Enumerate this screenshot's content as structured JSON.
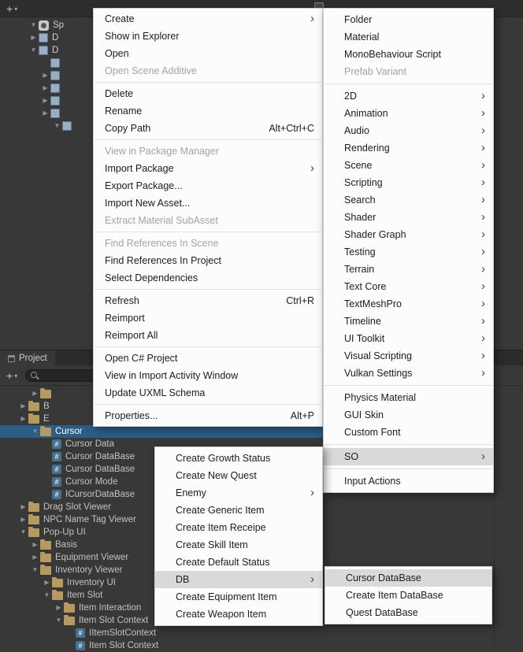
{
  "colors": {
    "selection_blue": "#2c5d87",
    "menu_highlight": "#d9d9d9",
    "folder_icon": "#b69a5f",
    "script_icon": "#46718f"
  },
  "glyphs": {
    "add": "+",
    "dropdown": "▾",
    "collapsed": "▶",
    "expanded": "▼",
    "submenu_arrow": "›",
    "script_hash": "#"
  },
  "hierarchy": {
    "toolbar": {
      "add_label": "+",
      "caret": "▾"
    },
    "rows": [
      {
        "arrow": "down",
        "icon": "scene",
        "label": "Sp",
        "level": 0
      },
      {
        "arrow": "right",
        "icon": "cube",
        "label": "D",
        "level": 0
      },
      {
        "arrow": "down",
        "icon": "cube",
        "label": "D",
        "level": 0
      },
      {
        "icon": "cube",
        "label": "",
        "level": 1
      },
      {
        "arrow": "right",
        "icon": "cube",
        "label": "",
        "level": 1
      },
      {
        "arrow": "right",
        "icon": "cube",
        "label": "",
        "level": 1
      },
      {
        "arrow": "right",
        "icon": "cube",
        "label": "",
        "level": 1
      },
      {
        "arrow": "right",
        "icon": "cube",
        "label": "",
        "level": 1
      },
      {
        "arrow": "down",
        "icon": "cube",
        "label": "",
        "level": 2
      }
    ]
  },
  "project": {
    "tab_label": "Project",
    "toolbar": {
      "add_label": "+",
      "caret": "▾",
      "search_value": ""
    },
    "rows": [
      {
        "arrow": "right",
        "icon": "folder",
        "label": "",
        "level": 2
      },
      {
        "arrow": "right",
        "icon": "folder",
        "label": "B",
        "level": 1
      },
      {
        "arrow": "right",
        "icon": "folder",
        "label": "E",
        "level": 1
      },
      {
        "arrow": "down",
        "icon": "folder",
        "label": "Cursor",
        "level": 2,
        "selected": true
      },
      {
        "icon": "script",
        "label": "Cursor Data",
        "level": 3
      },
      {
        "icon": "script",
        "label": "Cursor DataBase",
        "level": 3
      },
      {
        "icon": "script",
        "label": "Cursor DataBase",
        "level": 3
      },
      {
        "icon": "script",
        "label": "Cursor Mode",
        "level": 3
      },
      {
        "icon": "script",
        "label": "ICursorDataBase",
        "level": 3
      },
      {
        "arrow": "right",
        "icon": "folder",
        "label": "Drag Slot Viewer",
        "level": 1
      },
      {
        "arrow": "right",
        "icon": "folder",
        "label": "NPC Name Tag Viewer",
        "level": 1
      },
      {
        "arrow": "down",
        "icon": "folder",
        "label": "Pop-Up UI",
        "level": 1
      },
      {
        "arrow": "right",
        "icon": "folder",
        "label": "Basis",
        "level": 2
      },
      {
        "arrow": "right",
        "icon": "folder",
        "label": "Equipment Viewer",
        "level": 2
      },
      {
        "arrow": "down",
        "icon": "folder",
        "label": "Inventory Viewer",
        "level": 2
      },
      {
        "arrow": "right",
        "icon": "folder",
        "label": "Inventory UI",
        "level": 3
      },
      {
        "arrow": "down",
        "icon": "folder",
        "label": "Item Slot",
        "level": 3
      },
      {
        "arrow": "right",
        "icon": "folder",
        "label": "Item Interaction",
        "level": 4
      },
      {
        "arrow": "down",
        "icon": "folder",
        "label": "Item Slot Context",
        "level": 4
      },
      {
        "icon": "script",
        "label": "IItemSlotContext",
        "level": 5
      },
      {
        "icon": "script",
        "label": "Item Slot Context",
        "level": 5
      }
    ]
  },
  "menus": {
    "main": {
      "items": [
        {
          "label": "Create",
          "submenu": true
        },
        {
          "label": "Show in Explorer"
        },
        {
          "label": "Open"
        },
        {
          "label": "Open Scene Additive",
          "disabled": true
        },
        {
          "type": "sep"
        },
        {
          "label": "Delete"
        },
        {
          "label": "Rename"
        },
        {
          "label": "Copy Path",
          "shortcut": "Alt+Ctrl+C"
        },
        {
          "type": "sep"
        },
        {
          "label": "View in Package Manager",
          "disabled": true
        },
        {
          "label": "Import Package",
          "submenu": true
        },
        {
          "label": "Export Package..."
        },
        {
          "label": "Import New Asset..."
        },
        {
          "label": "Extract Material SubAsset",
          "disabled": true
        },
        {
          "type": "sep"
        },
        {
          "label": "Find References In Scene",
          "disabled": true
        },
        {
          "label": "Find References In Project"
        },
        {
          "label": "Select Dependencies"
        },
        {
          "type": "sep"
        },
        {
          "label": "Refresh",
          "shortcut": "Ctrl+R"
        },
        {
          "label": "Reimport"
        },
        {
          "label": "Reimport All"
        },
        {
          "type": "sep"
        },
        {
          "label": "Open C# Project"
        },
        {
          "label": "View in Import Activity Window"
        },
        {
          "label": "Update UXML Schema"
        },
        {
          "type": "sep"
        },
        {
          "label": "Properties...",
          "shortcut": "Alt+P"
        }
      ]
    },
    "create": {
      "items": [
        {
          "label": "Folder"
        },
        {
          "label": "Material"
        },
        {
          "label": "MonoBehaviour Script"
        },
        {
          "label": "Prefab Variant",
          "disabled": true
        },
        {
          "type": "sep"
        },
        {
          "label": "2D",
          "submenu": true
        },
        {
          "label": "Animation",
          "submenu": true
        },
        {
          "label": "Audio",
          "submenu": true
        },
        {
          "label": "Rendering",
          "submenu": true
        },
        {
          "label": "Scene",
          "submenu": true
        },
        {
          "label": "Scripting",
          "submenu": true
        },
        {
          "label": "Search",
          "submenu": true
        },
        {
          "label": "Shader",
          "submenu": true
        },
        {
          "label": "Shader Graph",
          "submenu": true
        },
        {
          "label": "Testing",
          "submenu": true
        },
        {
          "label": "Terrain",
          "submenu": true
        },
        {
          "label": "Text Core",
          "submenu": true
        },
        {
          "label": "TextMeshPro",
          "submenu": true
        },
        {
          "label": "Timeline",
          "submenu": true
        },
        {
          "label": "UI Toolkit",
          "submenu": true
        },
        {
          "label": "Visual Scripting",
          "submenu": true
        },
        {
          "label": "Vulkan Settings",
          "submenu": true
        },
        {
          "type": "sep"
        },
        {
          "label": "Physics Material"
        },
        {
          "label": "GUI Skin"
        },
        {
          "label": "Custom Font"
        },
        {
          "type": "sep"
        },
        {
          "label": "SO",
          "submenu": true,
          "highlight": true
        },
        {
          "type": "sep"
        },
        {
          "label": "Input Actions"
        }
      ]
    },
    "so": {
      "items": [
        {
          "label": "Create Growth Status"
        },
        {
          "label": "Create New Quest"
        },
        {
          "label": "Enemy",
          "submenu": true
        },
        {
          "label": "Create Generic Item"
        },
        {
          "label": "Create Item Receipe"
        },
        {
          "label": "Create Skill Item"
        },
        {
          "label": "Create Default Status"
        },
        {
          "label": "DB",
          "submenu": true,
          "highlight": true
        },
        {
          "label": "Create Equipment Item"
        },
        {
          "label": "Create Weapon Item"
        }
      ]
    },
    "db": {
      "items": [
        {
          "label": "Cursor DataBase",
          "highlight": true
        },
        {
          "label": "Create Item DataBase"
        },
        {
          "label": "Quest DataBase"
        }
      ]
    }
  }
}
